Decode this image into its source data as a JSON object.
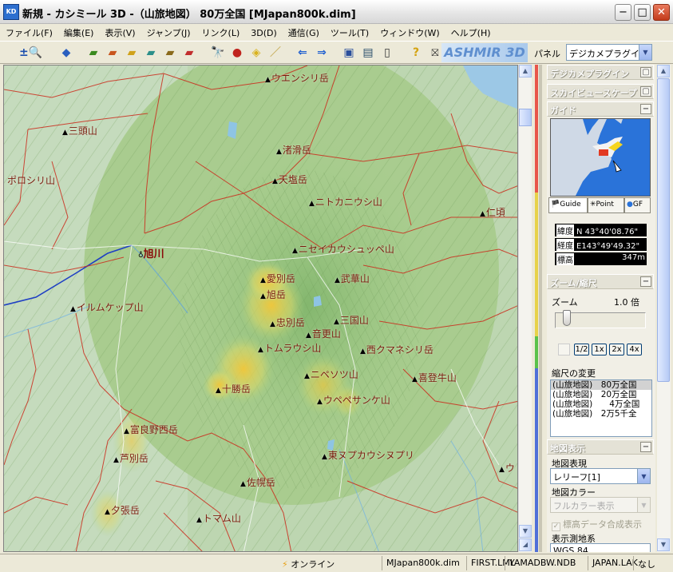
{
  "window": {
    "title": "新規 - カシミール 3D -（山旅地図） 80万全国 [MJapan800k.dim]",
    "app_icon": "KD"
  },
  "menu": [
    "ファイル(F)",
    "編集(E)",
    "表示(V)",
    "ジャンプ(J)",
    "リンク(L)",
    "3D(D)",
    "通信(G)",
    "ツール(T)",
    "ウィンドウ(W)",
    "ヘルプ(H)"
  ],
  "toolbar": {
    "brand": "ASHMIR 3D",
    "panel_label": "パネル",
    "panel_select": "デジカメプラグイ"
  },
  "map": {
    "city": "旭川",
    "peaks": [
      {
        "name": "ウエンシリ岳"
      },
      {
        "name": "三頭山"
      },
      {
        "name": "渚滑岳"
      },
      {
        "name": "ポロシリ山"
      },
      {
        "name": "天塩岳"
      },
      {
        "name": "ニトカニウシ山"
      },
      {
        "name": "仁頃"
      },
      {
        "name": "ニセイカウシュッペ山"
      },
      {
        "name": "愛別岳"
      },
      {
        "name": "武華山"
      },
      {
        "name": "旭岳"
      },
      {
        "name": "イルムケップ山"
      },
      {
        "name": "三国山"
      },
      {
        "name": "忠別岳"
      },
      {
        "name": "音更山"
      },
      {
        "name": "西クマネシリ岳"
      },
      {
        "name": "トムラウシ山"
      },
      {
        "name": "ニペソツ山"
      },
      {
        "name": "喜登牛山"
      },
      {
        "name": "十勝岳"
      },
      {
        "name": "ウペペサンケ山"
      },
      {
        "name": "富良野西岳"
      },
      {
        "name": "芦別岳"
      },
      {
        "name": "東ヌプカウシヌプリ"
      },
      {
        "name": "佐幌岳"
      },
      {
        "name": "夕張岳"
      },
      {
        "name": "トマム山"
      },
      {
        "name": "ウ"
      }
    ]
  },
  "panel": {
    "sections": {
      "digicam": "デジカメプラグイン",
      "skyview": "スカイビュースケープ",
      "guide": "ガイド",
      "zoom": "ズーム/縮尺",
      "mapdisplay": "地図表示"
    },
    "guide_tabs": [
      "Guide",
      "Point",
      "GF"
    ],
    "latitude_label": "緯度",
    "latitude": "N 43°40'08.76\"",
    "longitude_label": "経度",
    "longitude": "E143°49'49.32\"",
    "elevation_label": "標高",
    "elevation": "347m",
    "zoom_label": "ズーム",
    "zoom_value": "1.0 倍",
    "zoom_level": 0.1,
    "zoom_buttons": [
      "1/2",
      "1x",
      "2x",
      "4x"
    ],
    "scale_title": "縮尺の変更",
    "scale_items": [
      "(山旅地図)　80万全国",
      "(山旅地図)　20万全国",
      "(山旅地図)　　4万全国",
      "(山旅地図)　2万5千全"
    ],
    "map_expr_label": "地図表現",
    "map_expr_value": "レリーフ[1]",
    "map_color_label": "地図カラー",
    "map_color_value": "フルカラー表示",
    "elev_composite": "標高データ合成表示",
    "datum_label": "表示測地系",
    "datum_value": "WGS 84"
  },
  "status": {
    "online": "オンライン",
    "fields": [
      "MJapan800k.dim",
      "FIRST.LML",
      "YAMADBW.NDB",
      "JAPAN.LAK",
      "なし"
    ]
  }
}
